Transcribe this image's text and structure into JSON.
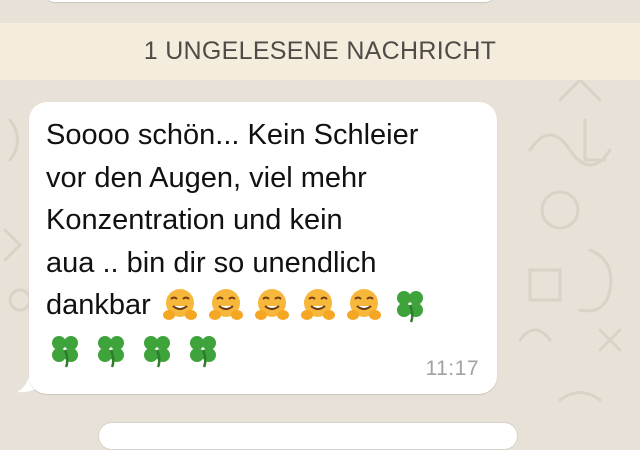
{
  "chat": {
    "unread_divider": "1 UNGELESENE NACHRICHT",
    "message": {
      "text": "Soooo schön... Kein Schleier\nvor den Augen, viel mehr\nKonzentration und kein\naua .. bin dir so unendlich",
      "last_line": "dankbar",
      "emojis_line5": [
        "hugging-face",
        "hugging-face",
        "hugging-face",
        "hugging-face",
        "hugging-face",
        "four-leaf-clover"
      ],
      "emojis_line6": [
        "four-leaf-clover",
        "four-leaf-clover",
        "four-leaf-clover",
        "four-leaf-clover"
      ],
      "time": "11:17"
    }
  },
  "colors": {
    "background": "#e7e1d7",
    "unread_bar": "#f4ecdd",
    "bubble": "#ffffff",
    "time": "#a2a2a2"
  }
}
